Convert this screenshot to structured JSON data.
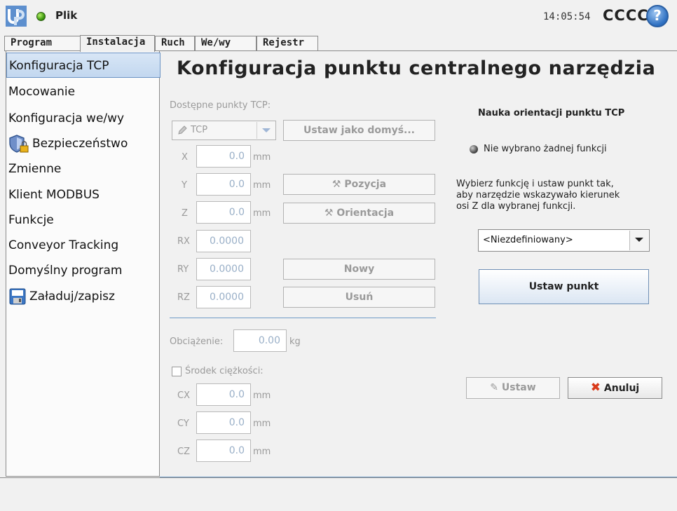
{
  "header": {
    "app_name": "Plik",
    "clock": "14:05:54",
    "robot_name": "CCCC",
    "help": "?"
  },
  "tabs": [
    {
      "label": "Program",
      "active": false
    },
    {
      "label": "Instalacja",
      "active": true
    },
    {
      "label": "Ruch",
      "active": false
    },
    {
      "label": "We/wy",
      "active": false
    },
    {
      "label": "Rejestr",
      "active": false
    }
  ],
  "sidebar": {
    "items": [
      {
        "label": "Konfiguracja TCP",
        "selected": true
      },
      {
        "label": "Mocowanie"
      },
      {
        "label": "Konfiguracja we/wy"
      },
      {
        "label": "Bezpieczeństwo",
        "icon": "shield-lock-icon"
      },
      {
        "label": "Zmienne"
      },
      {
        "label": "Klient MODBUS"
      },
      {
        "label": "Funkcje"
      },
      {
        "label": "Conveyor Tracking"
      },
      {
        "label": "Domyślny program"
      },
      {
        "label": "Załaduj/zapisz",
        "icon": "save-disk-icon"
      }
    ]
  },
  "main": {
    "title": "Konfiguracja punktu centralnego narzędzia",
    "available_label": "Dostępne punkty TCP:",
    "tcp_select": "TCP",
    "set_default_button": "Ustaw jako domyś...",
    "fields": {
      "x": {
        "label": "X",
        "value": "0.0",
        "unit": "mm"
      },
      "y": {
        "label": "Y",
        "value": "0.0",
        "unit": "mm"
      },
      "z": {
        "label": "Z",
        "value": "0.0",
        "unit": "mm"
      },
      "rx": {
        "label": "RX",
        "value": "0.0000"
      },
      "ry": {
        "label": "RY",
        "value": "0.0000"
      },
      "rz": {
        "label": "RZ",
        "value": "0.0000"
      }
    },
    "position_button": "Pozycja",
    "orientation_button": "Orientacja",
    "new_button": "Nowy",
    "delete_button": "Usuń",
    "payload_label": "Obciążenie:",
    "payload_value": "0.00",
    "payload_unit": "kg",
    "cog_label": "Środek ciężkości:",
    "cog": {
      "cx": {
        "label": "CX",
        "value": "0.0",
        "unit": "mm"
      },
      "cy": {
        "label": "CY",
        "value": "0.0",
        "unit": "mm"
      },
      "cz": {
        "label": "CZ",
        "value": "0.0",
        "unit": "mm"
      }
    }
  },
  "right_panel": {
    "title": "Nauka orientacji punktu TCP",
    "status": "Nie wybrano żadnej funkcji",
    "instructions": [
      "Wybierz funkcję i ustaw punkt tak,",
      "aby narzędzie wskazywało kierunek",
      "osi Z dla wybranej funkcji."
    ],
    "feature_select": "<Niezdefiniowany>",
    "set_point_button": "Ustaw punkt",
    "apply_button": "Ustaw",
    "cancel_button": "Anuluj"
  },
  "colors": {
    "selected_bg": "#c8daf0",
    "accent_line": "#6e9bc7",
    "cancel_x": "#d93a1a",
    "status_ok": "#3f9a10"
  }
}
